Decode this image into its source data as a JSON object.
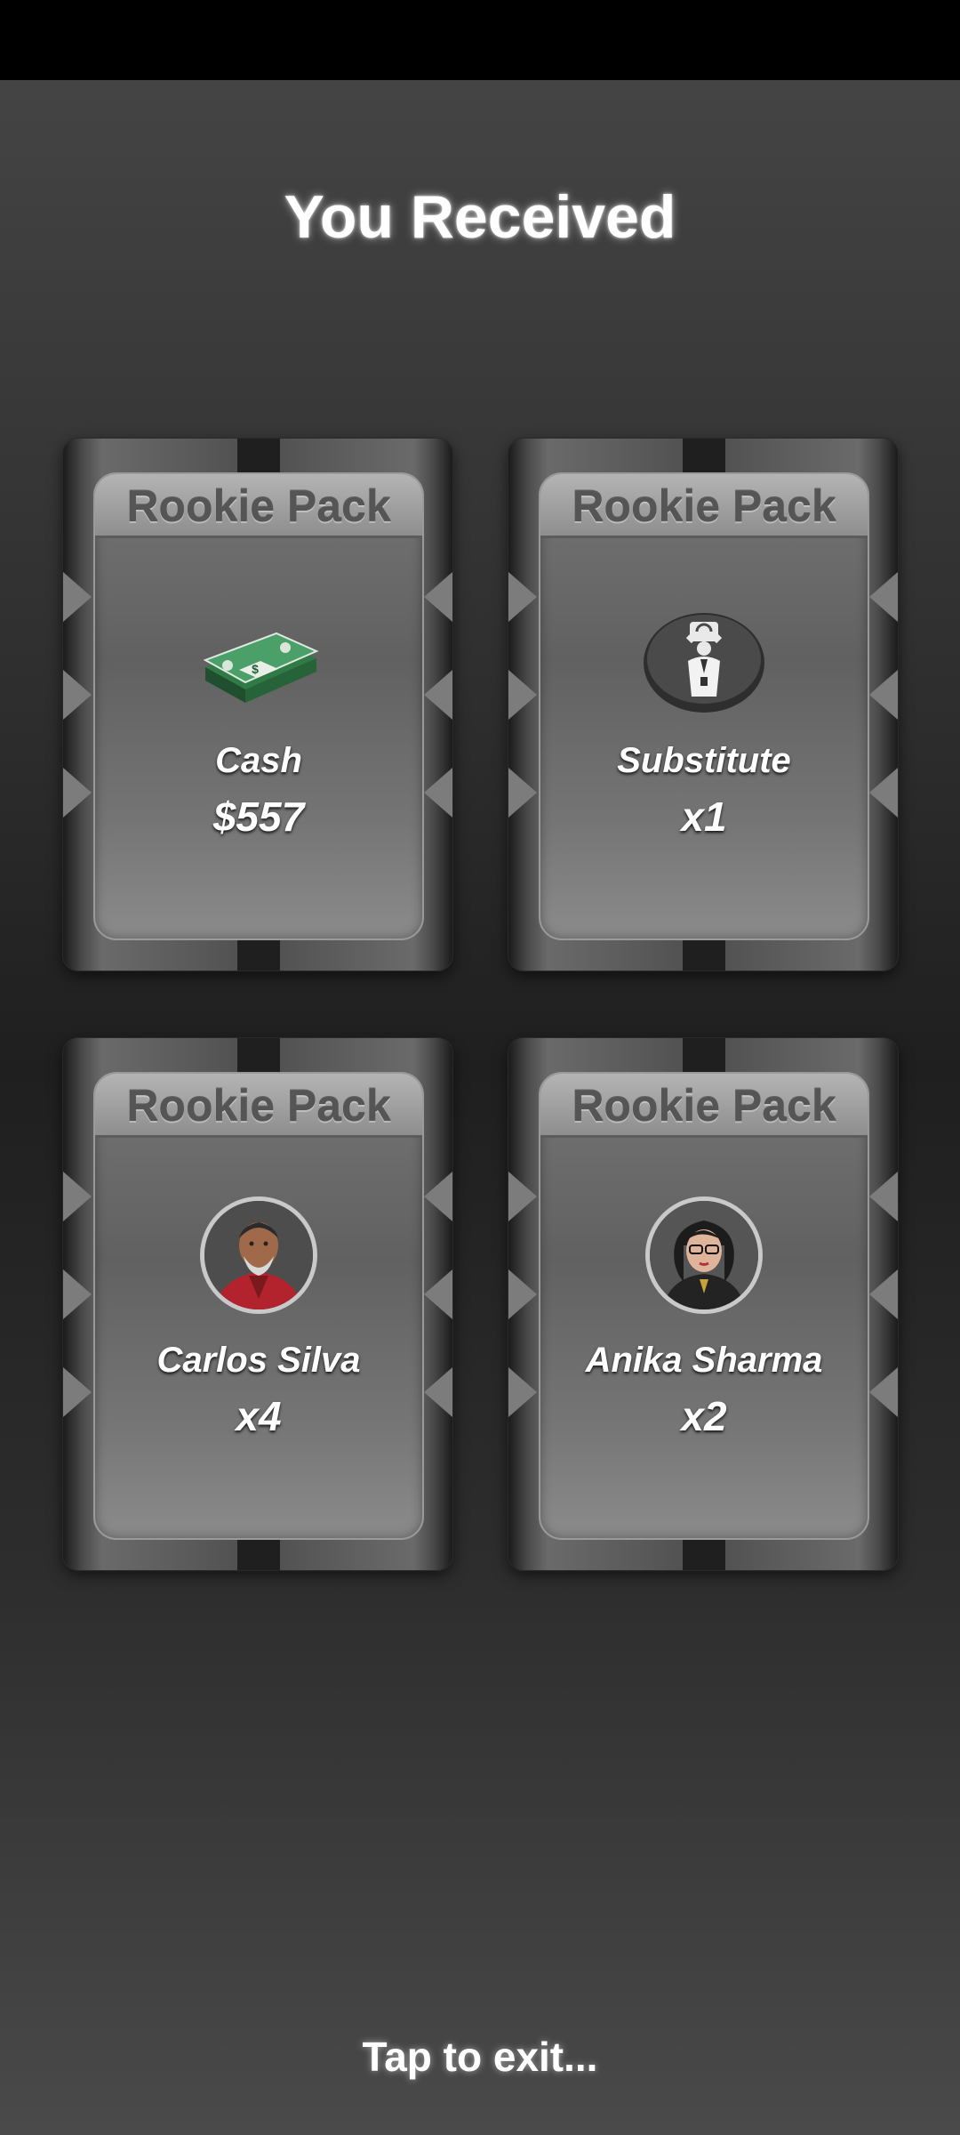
{
  "title": "You Received",
  "cards": [
    {
      "pack": "Rookie Pack",
      "name": "Cash",
      "amount": "$557",
      "icon": "cash-stack-icon"
    },
    {
      "pack": "Rookie Pack",
      "name": "Substitute",
      "amount": "x1",
      "icon": "substitute-icon"
    },
    {
      "pack": "Rookie Pack",
      "name": "Carlos Silva",
      "amount": "x4",
      "icon": "player-avatar-carlos"
    },
    {
      "pack": "Rookie Pack",
      "name": "Anika Sharma",
      "amount": "x2",
      "icon": "player-avatar-anika"
    }
  ],
  "footer": "Tap to exit..."
}
